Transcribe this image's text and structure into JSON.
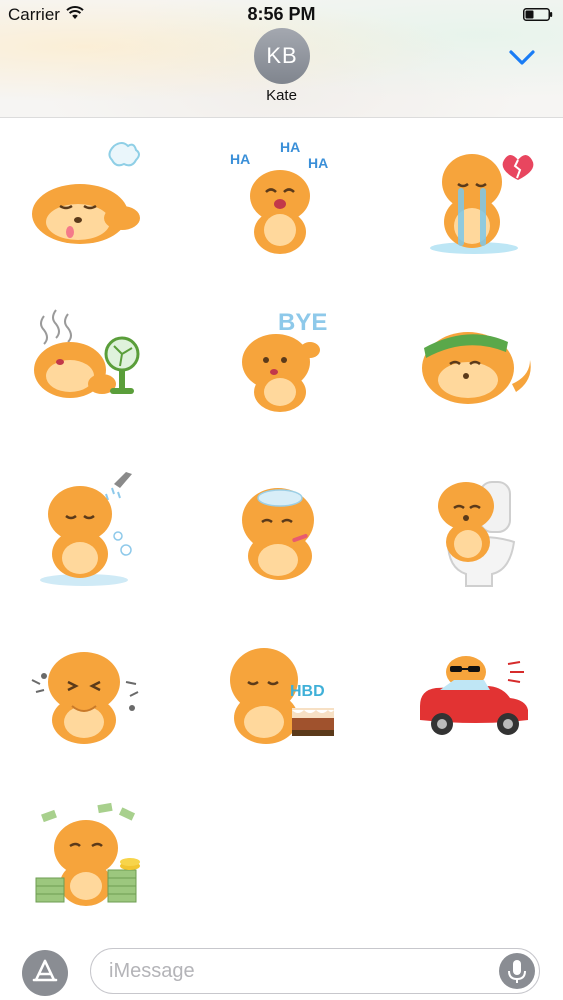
{
  "status_bar": {
    "carrier": "Carrier",
    "time": "8:56 PM"
  },
  "header": {
    "avatar_initials": "KB",
    "contact_name": "Kate",
    "collapse_icon": "chevron-down-icon",
    "accent_color": "#1a7cf5"
  },
  "stickers": {
    "items": [
      {
        "name": "sleeping-dog-sticker",
        "caption": ""
      },
      {
        "name": "laughing-dog-sticker",
        "caption": "HA"
      },
      {
        "name": "crying-heartbroken-dog-sticker",
        "caption": ""
      },
      {
        "name": "hot-dog-with-fan-sticker",
        "caption": ""
      },
      {
        "name": "waving-bye-dog-sticker",
        "caption": "BYE"
      },
      {
        "name": "headband-lying-dog-sticker",
        "caption": ""
      },
      {
        "name": "showering-dog-sticker",
        "caption": ""
      },
      {
        "name": "sick-dog-with-icepack-sticker",
        "caption": ""
      },
      {
        "name": "dog-on-toilet-sticker",
        "caption": ""
      },
      {
        "name": "sneezing-dog-sticker",
        "caption": ""
      },
      {
        "name": "birthday-cake-dog-sticker",
        "caption": "HBD"
      },
      {
        "name": "dog-driving-red-car-sticker",
        "caption": ""
      },
      {
        "name": "dog-with-money-sticker",
        "caption": ""
      }
    ]
  },
  "compose": {
    "app_store_icon": "app-store-icon",
    "placeholder": "iMessage",
    "mic_icon": "microphone-icon"
  }
}
